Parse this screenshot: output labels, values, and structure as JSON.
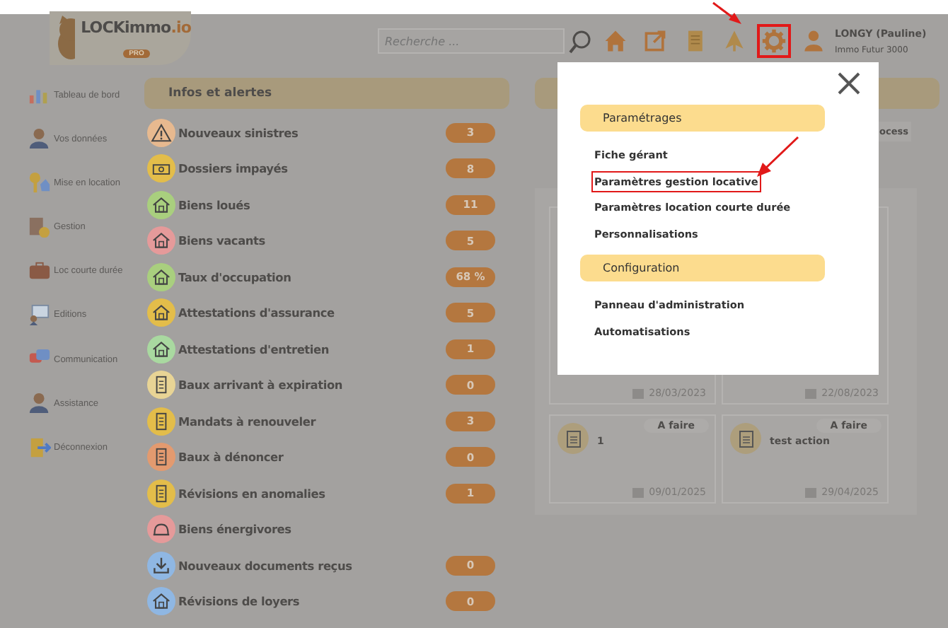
{
  "header": {
    "logo": {
      "name": "LOCKimmo",
      "suffix": ".io",
      "badge": "PRO"
    },
    "search": {
      "placeholder": "Recherche ..."
    },
    "toolbar_icons": [
      {
        "kind": "home",
        "highlighted": false
      },
      {
        "kind": "external",
        "highlighted": false
      },
      {
        "kind": "document",
        "highlighted": false
      },
      {
        "kind": "tree",
        "highlighted": false
      },
      {
        "kind": "gear",
        "highlighted": true
      },
      {
        "kind": "user",
        "highlighted": false
      }
    ],
    "user": {
      "name": "LONGY (Pauline)",
      "company": "Immo Futur 3000"
    }
  },
  "sidebar": {
    "items": [
      {
        "kind": "chart",
        "label": "Tableau de bord"
      },
      {
        "kind": "person",
        "label": "Vos données"
      },
      {
        "kind": "key",
        "label": "Mise en location"
      },
      {
        "kind": "calculator",
        "label": "Gestion"
      },
      {
        "kind": "suitcase",
        "label": "Loc courte durée"
      },
      {
        "kind": "screen",
        "label": "Editions"
      },
      {
        "kind": "chat",
        "label": "Communication"
      },
      {
        "kind": "person",
        "label": "Assistance"
      },
      {
        "kind": "exit",
        "label": "Déconnexion"
      }
    ]
  },
  "alerts": {
    "title": "Infos et alertes",
    "rows": [
      {
        "kind": "warning",
        "color": "#e7b98f",
        "label": "Nouveaux sinistres",
        "count": "3"
      },
      {
        "kind": "money",
        "color": "#e3bd4a",
        "label": "Dossiers impayés",
        "count": "8"
      },
      {
        "kind": "house",
        "color": "#a9cf7e",
        "label": "Biens loués",
        "count": "11"
      },
      {
        "kind": "house",
        "color": "#e59a9a",
        "label": "Biens vacants",
        "count": "5"
      },
      {
        "kind": "house",
        "color": "#a9cf7e",
        "label": "Taux d'occupation",
        "count": "68 %"
      },
      {
        "kind": "house",
        "color": "#e3bd4a",
        "label": "Attestations d'assurance",
        "count": "5"
      },
      {
        "kind": "house",
        "color": "#a9d9a0",
        "label": "Attestations d'entretien",
        "count": "1"
      },
      {
        "kind": "document",
        "color": "#e8d495",
        "label": "Baux arrivant à expiration",
        "count": "0"
      },
      {
        "kind": "document",
        "color": "#e3bd4a",
        "label": "Mandats à renouveler",
        "count": "3"
      },
      {
        "kind": "document",
        "color": "#e39a6f",
        "label": "Baux à dénoncer",
        "count": "0"
      },
      {
        "kind": "document",
        "color": "#e3bd4a",
        "label": "Révisions en anomalies",
        "count": "1"
      },
      {
        "kind": "bell",
        "color": "#e59a9a",
        "label": "Biens énergivores"
      },
      {
        "kind": "download",
        "color": "#8fb7e3",
        "label": "Nouveaux documents reçus",
        "count": "0"
      },
      {
        "kind": "house",
        "color": "#8fb7e3",
        "label": "Révisions de loyers",
        "count": "0"
      }
    ]
  },
  "tasks": {
    "tab_fragment": "ocess",
    "cards": [
      {
        "date": "28/03/2023"
      },
      {
        "date": "22/08/2023"
      },
      {
        "status": "A faire",
        "title": "1",
        "date": "09/01/2025"
      },
      {
        "status": "A faire",
        "title": "test action",
        "date": "29/04/2025"
      }
    ]
  },
  "settings_menu": {
    "sections": [
      {
        "title": "Paramétrages",
        "items": [
          {
            "label": "Fiche gérant",
            "highlighted": false
          },
          {
            "label": "Paramètres gestion locative",
            "highlighted": true
          },
          {
            "label": "Paramètres location courte durée",
            "highlighted": false
          },
          {
            "label": "Personnalisations",
            "highlighted": false
          }
        ]
      },
      {
        "title": "Configuration",
        "items": [
          {
            "label": "Panneau d'administration",
            "highlighted": false
          },
          {
            "label": "Automatisations",
            "highlighted": false
          }
        ]
      }
    ]
  }
}
